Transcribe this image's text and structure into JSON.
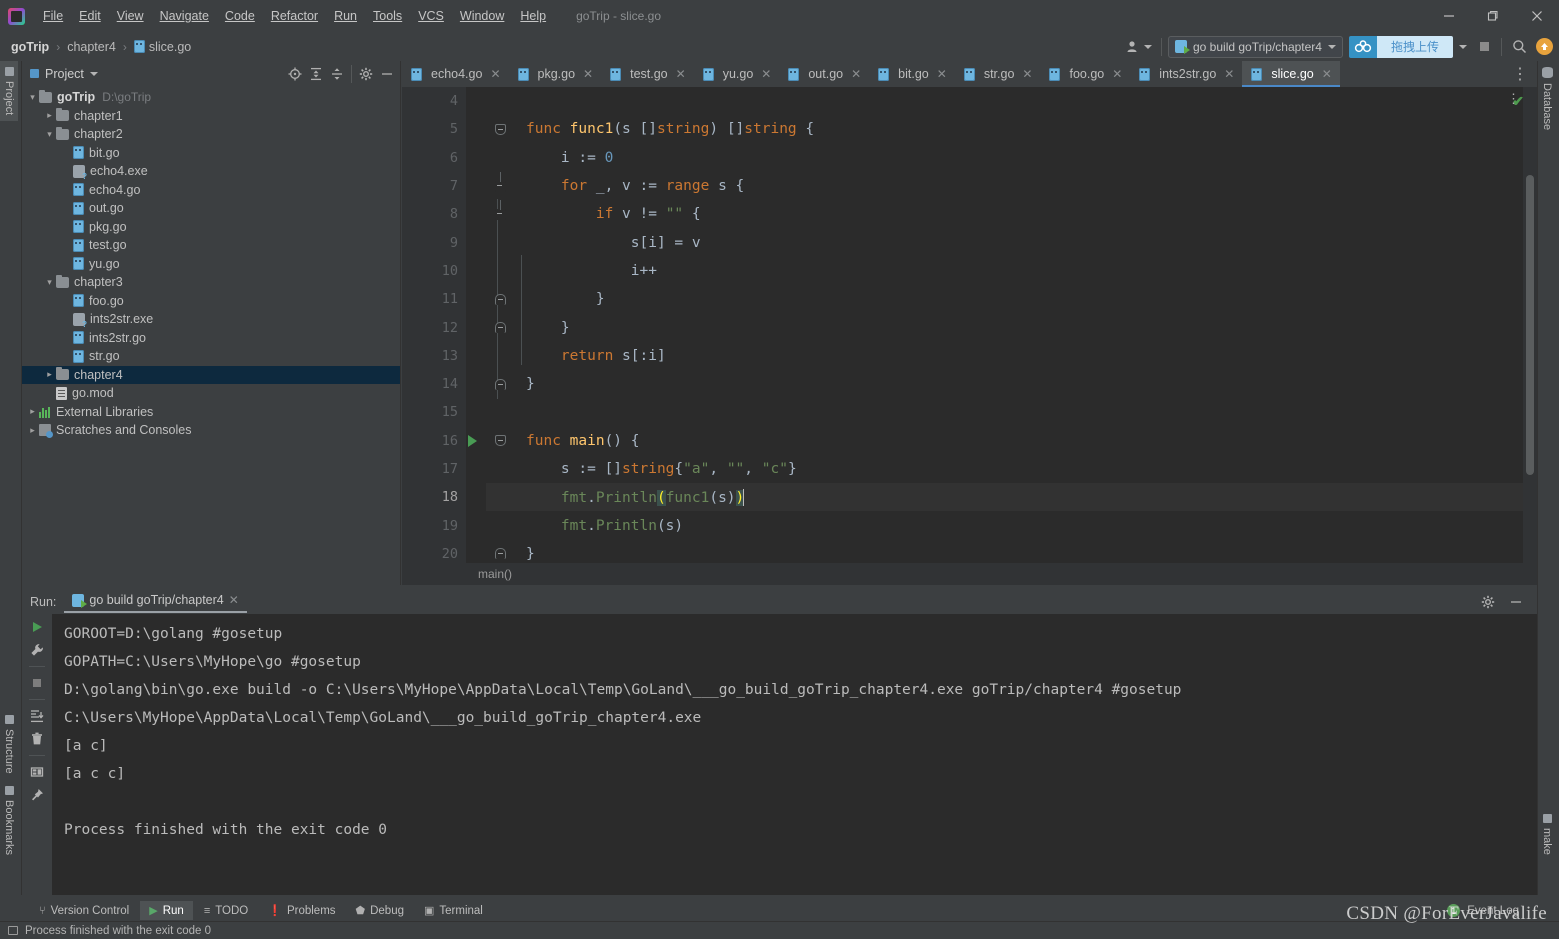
{
  "window": {
    "title": "goTrip - slice.go",
    "controls": {
      "minimize": "minimize-icon",
      "maximize": "maximize-icon",
      "close": "close-icon"
    }
  },
  "menubar": [
    {
      "label": "File"
    },
    {
      "label": "Edit"
    },
    {
      "label": "View"
    },
    {
      "label": "Navigate"
    },
    {
      "label": "Code"
    },
    {
      "label": "Refactor"
    },
    {
      "label": "Run"
    },
    {
      "label": "Tools"
    },
    {
      "label": "VCS"
    },
    {
      "label": "Window"
    },
    {
      "label": "Help"
    }
  ],
  "breadcrumb": {
    "sep": "›",
    "items": [
      {
        "label": "goTrip",
        "bold": true
      },
      {
        "label": "chapter4",
        "bold": false
      },
      {
        "label": "slice.go",
        "bold": false,
        "icon": "go-file-icon"
      }
    ]
  },
  "navbar_right": {
    "run_config": "go build goTrip/chapter4",
    "upload_label": "拖拽上传",
    "search_icon": "search-icon",
    "update_icon": "update-arrow-icon",
    "stop_icon": "stop-icon",
    "account_icon": "account-icon"
  },
  "left_strip": {
    "top": [
      {
        "label": "Project",
        "active": true
      }
    ],
    "bottom": [
      {
        "label": "Structure"
      },
      {
        "label": "Bookmarks"
      }
    ]
  },
  "right_strip": {
    "top": [
      {
        "label": "Database"
      }
    ],
    "bottom": [
      {
        "label": "make"
      }
    ]
  },
  "project_panel": {
    "title": "Project",
    "tools": [
      "locate-icon",
      "expand-all-icon",
      "collapse-all-icon",
      "settings-gear-icon",
      "hide-icon"
    ],
    "tree": [
      {
        "depth": 0,
        "label": "goTrip",
        "path": "D:\\goTrip",
        "icon": "folder-icon",
        "arrow": "down",
        "bold": true,
        "selected": false
      },
      {
        "depth": 1,
        "label": "chapter1",
        "icon": "folder-icon",
        "arrow": "right",
        "selected": false
      },
      {
        "depth": 1,
        "label": "chapter2",
        "icon": "folder-icon",
        "arrow": "down",
        "selected": false
      },
      {
        "depth": 2,
        "label": "bit.go",
        "icon": "go-file-icon",
        "arrow": "",
        "selected": false
      },
      {
        "depth": 2,
        "label": "echo4.exe",
        "icon": "exe-file-icon",
        "arrow": "",
        "selected": false
      },
      {
        "depth": 2,
        "label": "echo4.go",
        "icon": "go-file-icon",
        "arrow": "",
        "selected": false
      },
      {
        "depth": 2,
        "label": "out.go",
        "icon": "go-file-icon",
        "arrow": "",
        "selected": false
      },
      {
        "depth": 2,
        "label": "pkg.go",
        "icon": "go-file-icon",
        "arrow": "",
        "selected": false
      },
      {
        "depth": 2,
        "label": "test.go",
        "icon": "go-file-icon",
        "arrow": "",
        "selected": false
      },
      {
        "depth": 2,
        "label": "yu.go",
        "icon": "go-file-icon",
        "arrow": "",
        "selected": false
      },
      {
        "depth": 1,
        "label": "chapter3",
        "icon": "folder-icon",
        "arrow": "down",
        "selected": false
      },
      {
        "depth": 2,
        "label": "foo.go",
        "icon": "go-file-icon",
        "arrow": "",
        "selected": false
      },
      {
        "depth": 2,
        "label": "ints2str.exe",
        "icon": "exe-file-icon",
        "arrow": "",
        "selected": false
      },
      {
        "depth": 2,
        "label": "ints2str.go",
        "icon": "go-file-icon",
        "arrow": "",
        "selected": false
      },
      {
        "depth": 2,
        "label": "str.go",
        "icon": "go-file-icon",
        "arrow": "",
        "selected": false
      },
      {
        "depth": 1,
        "label": "chapter4",
        "icon": "folder-icon",
        "arrow": "right",
        "selected": true
      },
      {
        "depth": 1,
        "label": "go.mod",
        "icon": "mod-file-icon",
        "arrow": "",
        "selected": false
      },
      {
        "depth": 0,
        "label": "External Libraries",
        "icon": "library-icon",
        "arrow": "right",
        "selected": false
      },
      {
        "depth": 0,
        "label": "Scratches and Consoles",
        "icon": "scratches-icon",
        "arrow": "right",
        "selected": false
      }
    ]
  },
  "editor": {
    "tabs": [
      {
        "label": "echo4.go",
        "active": false
      },
      {
        "label": "pkg.go",
        "active": false
      },
      {
        "label": "test.go",
        "active": false
      },
      {
        "label": "yu.go",
        "active": false
      },
      {
        "label": "out.go",
        "active": false
      },
      {
        "label": "bit.go",
        "active": false
      },
      {
        "label": "str.go",
        "active": false
      },
      {
        "label": "foo.go",
        "active": false
      },
      {
        "label": "ints2str.go",
        "active": false
      },
      {
        "label": "slice.go",
        "active": true
      }
    ],
    "breadcrumb": "main()",
    "inspection_status": "✔",
    "lines": [
      {
        "n": "4",
        "fold": "",
        "gutter": "",
        "current": false,
        "tokens": []
      },
      {
        "n": "5",
        "fold": "top",
        "gutter": "",
        "current": false,
        "tokens": [
          {
            "t": "func ",
            "c": "kw"
          },
          {
            "t": "func1",
            "c": "fn"
          },
          {
            "t": "(s []",
            "c": "pln"
          },
          {
            "t": "string",
            "c": "kw"
          },
          {
            "t": ") []",
            "c": "pln"
          },
          {
            "t": "string",
            "c": "kw"
          },
          {
            "t": " {",
            "c": "pln"
          }
        ]
      },
      {
        "n": "6",
        "fold": "",
        "gutter": "",
        "current": false,
        "tokens": [
          {
            "t": "    i := ",
            "c": "pln"
          },
          {
            "t": "0",
            "c": "num"
          }
        ]
      },
      {
        "n": "7",
        "fold": "mid",
        "gutter": "",
        "current": false,
        "tokens": [
          {
            "t": "    ",
            "c": "pln"
          },
          {
            "t": "for",
            "c": "kw"
          },
          {
            "t": " _, v := ",
            "c": "pln"
          },
          {
            "t": "range",
            "c": "kw"
          },
          {
            "t": " s {",
            "c": "pln"
          }
        ]
      },
      {
        "n": "8",
        "fold": "mid",
        "gutter": "",
        "current": false,
        "tokens": [
          {
            "t": "        ",
            "c": "pln"
          },
          {
            "t": "if",
            "c": "kw"
          },
          {
            "t": " v != ",
            "c": "pln"
          },
          {
            "t": "\"\"",
            "c": "str"
          },
          {
            "t": " {",
            "c": "pln"
          }
        ]
      },
      {
        "n": "9",
        "fold": "",
        "gutter": "",
        "current": false,
        "tokens": [
          {
            "t": "            s[i] = v",
            "c": "pln"
          }
        ]
      },
      {
        "n": "10",
        "fold": "",
        "gutter": "",
        "current": false,
        "tokens": [
          {
            "t": "            i++",
            "c": "pln"
          }
        ]
      },
      {
        "n": "11",
        "fold": "end",
        "gutter": "",
        "current": false,
        "tokens": [
          {
            "t": "        }",
            "c": "pln"
          }
        ]
      },
      {
        "n": "12",
        "fold": "end",
        "gutter": "",
        "current": false,
        "tokens": [
          {
            "t": "    }",
            "c": "pln"
          }
        ]
      },
      {
        "n": "13",
        "fold": "",
        "gutter": "",
        "current": false,
        "tokens": [
          {
            "t": "    ",
            "c": "pln"
          },
          {
            "t": "return",
            "c": "kw"
          },
          {
            "t": " s[:i]",
            "c": "pln"
          }
        ]
      },
      {
        "n": "14",
        "fold": "end",
        "gutter": "",
        "current": false,
        "tokens": [
          {
            "t": "}",
            "c": "pln"
          }
        ]
      },
      {
        "n": "15",
        "fold": "",
        "gutter": "",
        "current": false,
        "tokens": []
      },
      {
        "n": "16",
        "fold": "top",
        "gutter": "run-gutter-icon",
        "current": false,
        "tokens": [
          {
            "t": "func ",
            "c": "kw"
          },
          {
            "t": "main",
            "c": "fn"
          },
          {
            "t": "() {",
            "c": "pln"
          }
        ]
      },
      {
        "n": "17",
        "fold": "",
        "gutter": "",
        "current": false,
        "tokens": [
          {
            "t": "    s := []",
            "c": "pln"
          },
          {
            "t": "string",
            "c": "kw"
          },
          {
            "t": "{",
            "c": "pln"
          },
          {
            "t": "\"a\"",
            "c": "str"
          },
          {
            "t": ", ",
            "c": "pln"
          },
          {
            "t": "\"\"",
            "c": "str"
          },
          {
            "t": ", ",
            "c": "pln"
          },
          {
            "t": "\"c\"",
            "c": "str"
          },
          {
            "t": "}",
            "c": "pln"
          }
        ]
      },
      {
        "n": "18",
        "fold": "",
        "gutter": "",
        "current": true,
        "tokens": [
          {
            "t": "    fmt",
            "c": "str"
          },
          {
            "t": ".",
            "c": "pln"
          },
          {
            "t": "Println",
            "c": "str"
          },
          {
            "t": "(",
            "c": "brk"
          },
          {
            "t": "func1",
            "c": "str"
          },
          {
            "t": "(s)",
            "c": "pln"
          },
          {
            "t": ")",
            "c": "brk"
          }
        ],
        "caret": true
      },
      {
        "n": "19",
        "fold": "",
        "gutter": "",
        "current": false,
        "tokens": [
          {
            "t": "    fmt",
            "c": "str"
          },
          {
            "t": ".",
            "c": "pln"
          },
          {
            "t": "Println",
            "c": "str"
          },
          {
            "t": "(s)",
            "c": "pln"
          }
        ]
      },
      {
        "n": "20",
        "fold": "end",
        "gutter": "",
        "current": false,
        "tokens": [
          {
            "t": "}",
            "c": "pln"
          }
        ]
      }
    ]
  },
  "run_panel": {
    "label": "Run:",
    "tab": "go build goTrip/chapter4",
    "tools": [
      "rerun-icon",
      "settings-wrench-icon",
      "stop-icon",
      "scroll-to-end-icon",
      "clear-all-icon",
      "soft-wrap-icon",
      "pin-tab-icon"
    ],
    "header_tools": [
      "settings-gear-icon",
      "hide-icon"
    ],
    "console": [
      "GOROOT=D:\\golang #gosetup",
      "GOPATH=C:\\Users\\MyHope\\go #gosetup",
      "D:\\golang\\bin\\go.exe build -o C:\\Users\\MyHope\\AppData\\Local\\Temp\\GoLand\\___go_build_goTrip_chapter4.exe goTrip/chapter4 #gosetup",
      "C:\\Users\\MyHope\\AppData\\Local\\Temp\\GoLand\\___go_build_goTrip_chapter4.exe",
      "[a c]",
      "[a c c]",
      "",
      "Process finished with the exit code 0"
    ]
  },
  "status_tabs": [
    {
      "label": "Version Control",
      "icon": "branch-icon",
      "active": false
    },
    {
      "label": "Run",
      "icon": "play-icon",
      "active": true
    },
    {
      "label": "TODO",
      "icon": "list-icon",
      "active": false
    },
    {
      "label": "Problems",
      "icon": "warning-icon",
      "active": false
    },
    {
      "label": "Debug",
      "icon": "bug-icon",
      "active": false
    },
    {
      "label": "Terminal",
      "icon": "terminal-icon",
      "active": false
    }
  ],
  "event_log": {
    "count": "1",
    "label": "Event Log"
  },
  "statusbar": {
    "message": "Process finished with the exit code 0"
  },
  "watermark": "CSDN @ForEverJavalife",
  "colors": {
    "accent_blue": "#3592c4",
    "panel_bg": "#3c3f41",
    "editor_bg": "#2b2b2b",
    "gutter_bg": "#313335",
    "selection_blue": "#0d293e",
    "keyword_orange": "#cc7832",
    "string_green": "#6a8759",
    "number_blue": "#6897bb",
    "function_yellow": "#ffc66d",
    "plain_text": "#a9b7c6",
    "run_green": "#499c54"
  }
}
